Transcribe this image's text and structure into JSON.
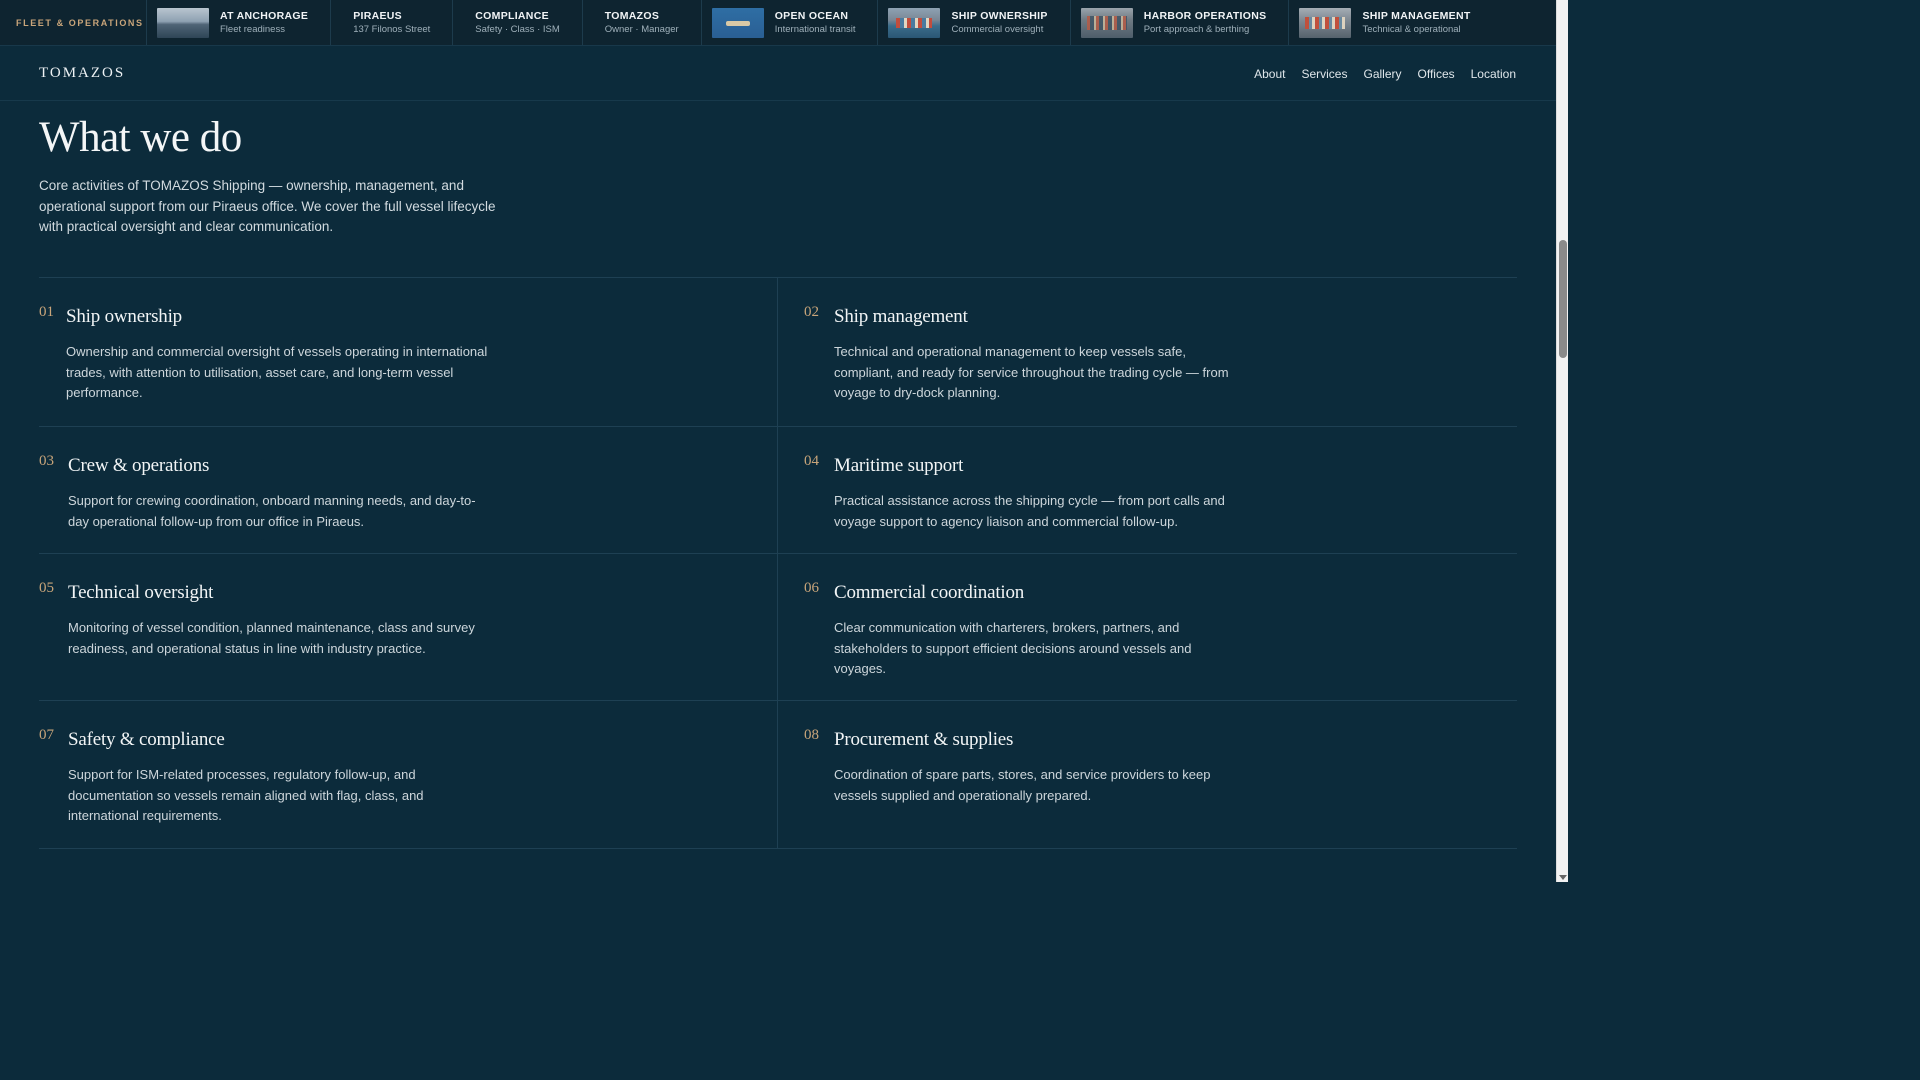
{
  "strip": {
    "brand": "FLEET & OPERATIONS",
    "items": [
      {
        "title": "AT ANCHORAGE",
        "subtitle": "Fleet readiness",
        "thumb": "anchorage-photo"
      },
      {
        "title": "PIRAEUS",
        "subtitle": "137 Filonos Street"
      },
      {
        "title": "COMPLIANCE",
        "subtitle": "Safety · Class · ISM"
      },
      {
        "title": "TOMAZOS",
        "subtitle": "Owner · Manager"
      },
      {
        "title": "OPEN OCEAN",
        "subtitle": "International transit",
        "thumb": "ocean-photo"
      },
      {
        "title": "SHIP OWNERSHIP",
        "subtitle": "Commercial oversight",
        "thumb": "container-ship-photo"
      },
      {
        "title": "HARBOR OPERATIONS",
        "subtitle": "Port approach & berthing",
        "thumb": "harbor-photo"
      },
      {
        "title": "SHIP MANAGEMENT",
        "subtitle": "Technical & operational",
        "thumb": "cargo-ship-photo"
      }
    ]
  },
  "header": {
    "logo": "TOMAZOS",
    "nav": [
      "About",
      "Services",
      "Gallery",
      "Offices",
      "Location"
    ]
  },
  "intro": {
    "title": "What we do",
    "text": "Core activities of TOMAZOS Shipping — ownership, management, and operational support from our Piraeus office. We cover the full vessel lifecycle with practical oversight and clear communication."
  },
  "services": [
    {
      "num": "01",
      "title": "Ship ownership",
      "text": "Ownership and commercial oversight of vessels operating in international trades, with attention to utilisation, asset care, and long-term vessel performance."
    },
    {
      "num": "02",
      "title": "Ship management",
      "text": "Technical and operational management to keep vessels safe, compliant, and ready for service throughout the trading cycle — from voyage to dry-dock planning."
    },
    {
      "num": "03",
      "title": "Crew & operations",
      "text": "Support for crewing coordination, onboard manning needs, and day-to-day operational follow-up from our office in Piraeus."
    },
    {
      "num": "04",
      "title": "Maritime support",
      "text": "Practical assistance across the shipping cycle — from port calls and voyage support to agency liaison and commercial follow-up."
    },
    {
      "num": "05",
      "title": "Technical oversight",
      "text": "Monitoring of vessel condition, planned maintenance, class and survey readiness, and operational status in line with industry practice."
    },
    {
      "num": "06",
      "title": "Commercial coordination",
      "text": "Clear communication with charterers, brokers, partners, and stakeholders to support efficient decisions around vessels and voyages."
    },
    {
      "num": "07",
      "title": "Safety & compliance",
      "text": "Support for ISM-related processes, regulatory follow-up, and documentation so vessels remain aligned with flag, class, and international requirements."
    },
    {
      "num": "08",
      "title": "Procurement & supplies",
      "text": "Coordination of spare parts, stores, and service providers to keep vessels supplied and operationally prepared."
    }
  ],
  "colors": {
    "background": "#0c2b3b",
    "accent": "#c9a57a",
    "strip": "#0e2430"
  }
}
